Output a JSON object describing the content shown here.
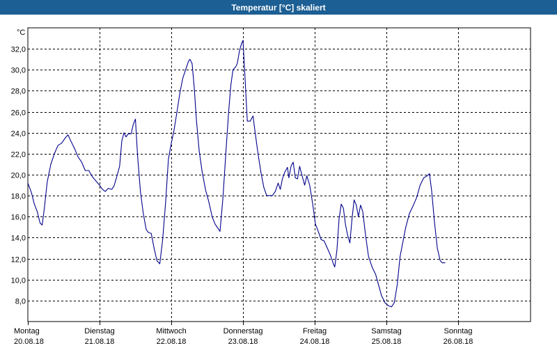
{
  "window": {
    "title": "Temperatur [°C] skaliert"
  },
  "colors": {
    "titlebar": "#1c5f94",
    "line": "#00008b",
    "grid": "#000000",
    "background": "#ffffff"
  },
  "chart_data": {
    "type": "line",
    "title": "Temperatur [°C] skaliert",
    "ylabel": "°C",
    "xlabel": "",
    "ylim": [
      6.0,
      34.0
    ],
    "xlim": [
      0,
      7
    ],
    "yticks": [
      "8,0",
      "10,0",
      "12,0",
      "14,0",
      "16,0",
      "18,0",
      "20,0",
      "22,0",
      "24,0",
      "26,0",
      "28,0",
      "30,0",
      "32,0"
    ],
    "ytick_values": [
      8,
      10,
      12,
      14,
      16,
      18,
      20,
      22,
      24,
      26,
      28,
      30,
      32
    ],
    "xticks": [
      {
        "day": "Montag",
        "date": "20.08.18"
      },
      {
        "day": "Dienstag",
        "date": "21.08.18"
      },
      {
        "day": "Mittwoch",
        "date": "22.08.18"
      },
      {
        "day": "Donnerstag",
        "date": "23.08.18"
      },
      {
        "day": "Freitag",
        "date": "24.08.18"
      },
      {
        "day": "Samstag",
        "date": "25.08.18"
      },
      {
        "day": "Sonntag",
        "date": "26.08.18"
      }
    ],
    "grid": true,
    "series": [
      {
        "values": [
          [
            0.0,
            19.2
          ],
          [
            0.05,
            18.3
          ],
          [
            0.09,
            17.2
          ],
          [
            0.13,
            16.5
          ],
          [
            0.17,
            15.4
          ],
          [
            0.2,
            15.2
          ],
          [
            0.23,
            16.8
          ],
          [
            0.27,
            19.3
          ],
          [
            0.32,
            21.0
          ],
          [
            0.37,
            22.0
          ],
          [
            0.42,
            22.8
          ],
          [
            0.47,
            23.0
          ],
          [
            0.52,
            23.5
          ],
          [
            0.56,
            23.8
          ],
          [
            0.6,
            23.2
          ],
          [
            0.65,
            22.5
          ],
          [
            0.7,
            21.7
          ],
          [
            0.75,
            21.2
          ],
          [
            0.8,
            20.4
          ],
          [
            0.85,
            20.4
          ],
          [
            0.9,
            19.8
          ],
          [
            0.95,
            19.4
          ],
          [
            1.0,
            19.0
          ],
          [
            1.04,
            18.6
          ],
          [
            1.08,
            18.4
          ],
          [
            1.12,
            18.7
          ],
          [
            1.17,
            18.6
          ],
          [
            1.2,
            18.9
          ],
          [
            1.24,
            19.8
          ],
          [
            1.28,
            20.8
          ],
          [
            1.31,
            23.2
          ],
          [
            1.34,
            24.0
          ],
          [
            1.37,
            23.6
          ],
          [
            1.4,
            23.9
          ],
          [
            1.44,
            23.9
          ],
          [
            1.47,
            24.8
          ],
          [
            1.5,
            25.3
          ],
          [
            1.53,
            21.8
          ],
          [
            1.57,
            18.4
          ],
          [
            1.61,
            16.3
          ],
          [
            1.65,
            14.8
          ],
          [
            1.68,
            14.5
          ],
          [
            1.72,
            14.4
          ],
          [
            1.76,
            13.0
          ],
          [
            1.8,
            11.8
          ],
          [
            1.84,
            11.5
          ],
          [
            1.88,
            13.8
          ],
          [
            1.92,
            17.3
          ],
          [
            1.96,
            21.5
          ],
          [
            2.0,
            23.0
          ],
          [
            2.04,
            24.3
          ],
          [
            2.08,
            26.0
          ],
          [
            2.12,
            27.8
          ],
          [
            2.16,
            29.2
          ],
          [
            2.2,
            30.0
          ],
          [
            2.24,
            30.8
          ],
          [
            2.26,
            31.0
          ],
          [
            2.29,
            30.6
          ],
          [
            2.32,
            28.3
          ],
          [
            2.35,
            25.2
          ],
          [
            2.39,
            22.2
          ],
          [
            2.43,
            20.3
          ],
          [
            2.48,
            18.5
          ],
          [
            2.52,
            17.5
          ],
          [
            2.57,
            16.0
          ],
          [
            2.61,
            15.3
          ],
          [
            2.66,
            14.8
          ],
          [
            2.68,
            14.6
          ],
          [
            2.72,
            17.8
          ],
          [
            2.76,
            22.0
          ],
          [
            2.8,
            26.0
          ],
          [
            2.83,
            28.5
          ],
          [
            2.86,
            30.0
          ],
          [
            2.9,
            30.3
          ],
          [
            2.92,
            30.6
          ],
          [
            2.95,
            31.8
          ],
          [
            2.98,
            32.5
          ],
          [
            3.0,
            32.8
          ],
          [
            3.03,
            29.0
          ],
          [
            3.06,
            25.1
          ],
          [
            3.1,
            25.1
          ],
          [
            3.14,
            25.6
          ],
          [
            3.17,
            24.0
          ],
          [
            3.21,
            22.0
          ],
          [
            3.25,
            20.2
          ],
          [
            3.29,
            18.8
          ],
          [
            3.33,
            18.0
          ],
          [
            3.37,
            18.0
          ],
          [
            3.41,
            18.0
          ],
          [
            3.45,
            18.4
          ],
          [
            3.49,
            19.2
          ],
          [
            3.52,
            18.6
          ],
          [
            3.55,
            19.6
          ],
          [
            3.58,
            20.2
          ],
          [
            3.62,
            20.7
          ],
          [
            3.64,
            19.7
          ],
          [
            3.67,
            20.8
          ],
          [
            3.7,
            21.2
          ],
          [
            3.73,
            19.7
          ],
          [
            3.76,
            19.6
          ],
          [
            3.79,
            20.8
          ],
          [
            3.82,
            20.0
          ],
          [
            3.86,
            19.0
          ],
          [
            3.89,
            19.9
          ],
          [
            3.93,
            19.0
          ],
          [
            3.97,
            17.3
          ],
          [
            4.01,
            15.3
          ],
          [
            4.05,
            14.6
          ],
          [
            4.09,
            13.8
          ],
          [
            4.13,
            13.7
          ],
          [
            4.17,
            13.1
          ],
          [
            4.22,
            12.3
          ],
          [
            4.26,
            11.5
          ],
          [
            4.28,
            11.2
          ],
          [
            4.31,
            12.8
          ],
          [
            4.34,
            15.8
          ],
          [
            4.37,
            17.2
          ],
          [
            4.4,
            16.8
          ],
          [
            4.43,
            15.2
          ],
          [
            4.46,
            14.2
          ],
          [
            4.49,
            13.5
          ],
          [
            4.52,
            15.8
          ],
          [
            4.55,
            17.6
          ],
          [
            4.58,
            17.1
          ],
          [
            4.61,
            16.0
          ],
          [
            4.64,
            17.1
          ],
          [
            4.67,
            16.5
          ],
          [
            4.71,
            14.2
          ],
          [
            4.75,
            12.2
          ],
          [
            4.8,
            11.2
          ],
          [
            4.85,
            10.5
          ],
          [
            4.89,
            9.5
          ],
          [
            4.93,
            8.5
          ],
          [
            4.98,
            7.8
          ],
          [
            5.03,
            7.5
          ],
          [
            5.07,
            7.4
          ],
          [
            5.11,
            7.8
          ],
          [
            5.15,
            9.5
          ],
          [
            5.19,
            12.2
          ],
          [
            5.23,
            13.6
          ],
          [
            5.27,
            15.0
          ],
          [
            5.32,
            16.3
          ],
          [
            5.37,
            17.0
          ],
          [
            5.42,
            17.8
          ],
          [
            5.47,
            19.0
          ],
          [
            5.52,
            19.7
          ],
          [
            5.57,
            19.9
          ],
          [
            5.6,
            20.1
          ],
          [
            5.63,
            18.5
          ],
          [
            5.67,
            15.5
          ],
          [
            5.71,
            13.0
          ],
          [
            5.75,
            11.8
          ],
          [
            5.78,
            11.6
          ],
          [
            5.82,
            11.6
          ]
        ]
      }
    ]
  }
}
